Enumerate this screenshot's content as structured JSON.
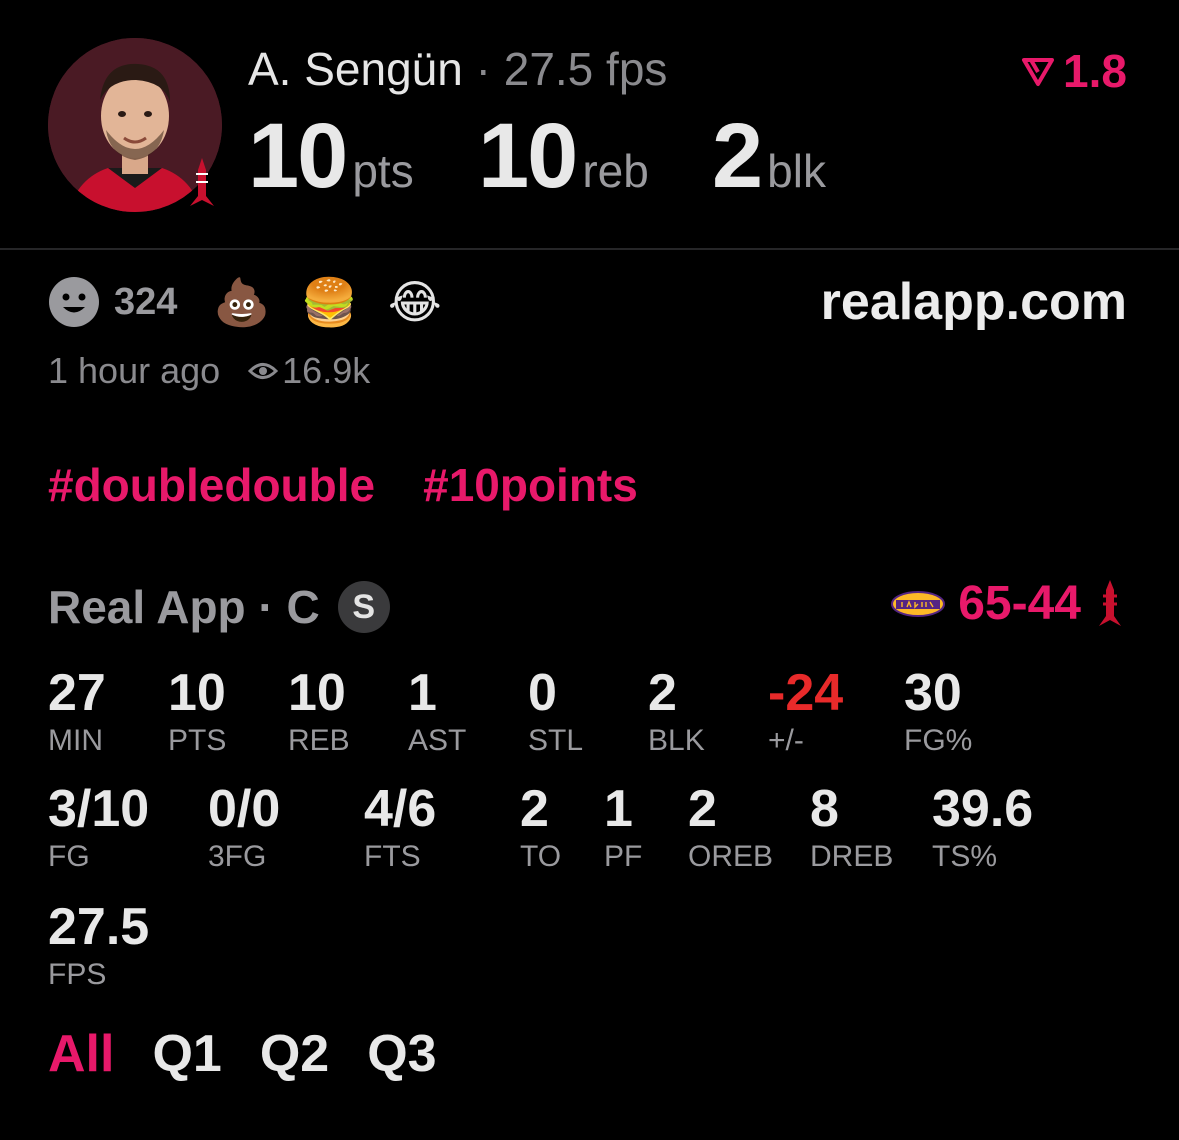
{
  "player": {
    "name": "A. Sengün",
    "separator": "·",
    "fps_label": "27.5 fps",
    "avatar_icon": "player-headshot",
    "team_icon": "rockets-logo-icon"
  },
  "top_stats": [
    {
      "value": "10",
      "unit": "pts"
    },
    {
      "value": "10",
      "unit": "reb"
    },
    {
      "value": "2",
      "unit": "blk"
    }
  ],
  "boost": {
    "value": "1.8",
    "icon": "boost-arrow-icon",
    "color": "#e8196a"
  },
  "reactions": {
    "smiley_icon": "smiley-icon",
    "count": "324",
    "emojis": [
      "💩",
      "🍔",
      "😂"
    ]
  },
  "site": "realapp.com",
  "meta": {
    "time": "1 hour ago",
    "eye_icon": "eye-icon",
    "views": "16.9k"
  },
  "tags": [
    "#doubledouble",
    "#10points"
  ],
  "game": {
    "league": "Real App · C",
    "badge": "S",
    "opponent_icon": "lakers-logo-icon",
    "score_left": "65",
    "score_dash": "-",
    "score_right": "44",
    "team_icon": "rockets-logo-icon"
  },
  "box": {
    "row1": [
      {
        "v": "27",
        "l": "MIN"
      },
      {
        "v": "10",
        "l": "PTS"
      },
      {
        "v": "10",
        "l": "REB"
      },
      {
        "v": "1",
        "l": "AST"
      },
      {
        "v": "0",
        "l": "STL"
      },
      {
        "v": "2",
        "l": "BLK"
      },
      {
        "v": "-24",
        "l": "+/-"
      },
      {
        "v": "30",
        "l": "FG%"
      }
    ],
    "row2": [
      {
        "v": "3/10",
        "l": "FG"
      },
      {
        "v": "0/0",
        "l": "3FG"
      },
      {
        "v": "4/6",
        "l": "FTS"
      },
      {
        "v": "2",
        "l": "TO"
      },
      {
        "v": "1",
        "l": "PF"
      },
      {
        "v": "2",
        "l": "OREB"
      },
      {
        "v": "8",
        "l": "DREB"
      },
      {
        "v": "39.6",
        "l": "TS%"
      }
    ],
    "row3": [
      {
        "v": "27.5",
        "l": "FPS"
      }
    ]
  },
  "periods": [
    "All",
    "Q1",
    "Q2",
    "Q3"
  ],
  "active_period": "All",
  "colors": {
    "accent": "#e8196a",
    "negative": "#e82a2a",
    "muted": "#9a9a9e"
  }
}
